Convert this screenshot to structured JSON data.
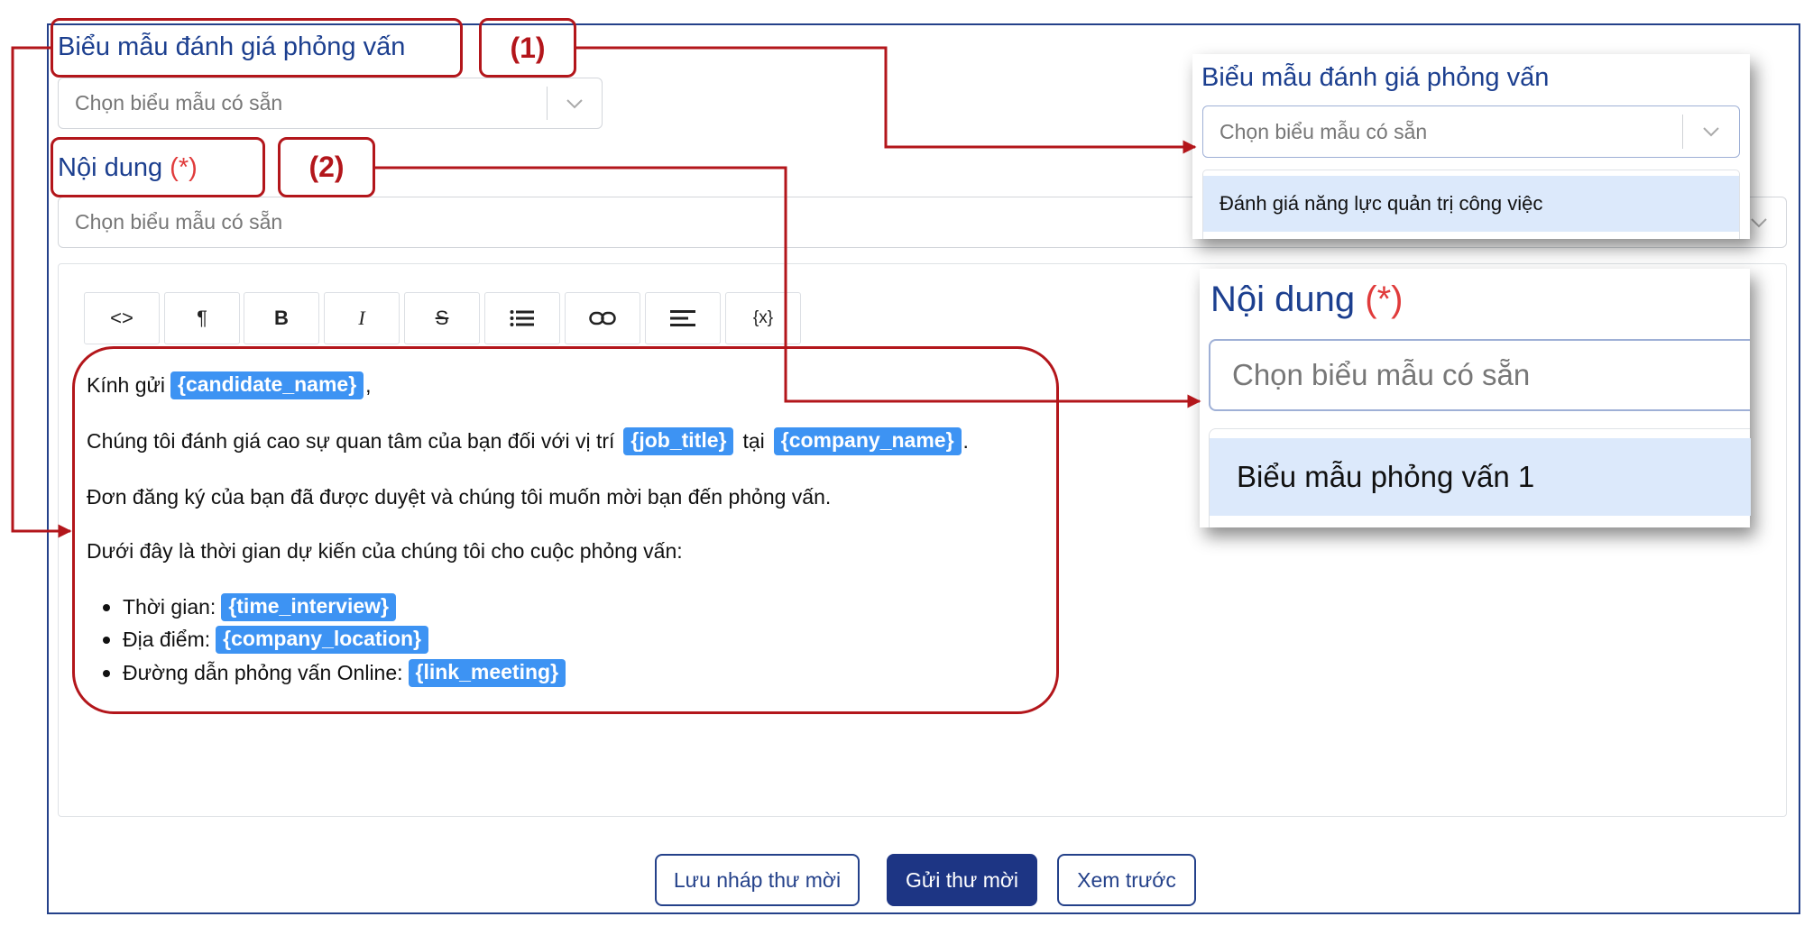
{
  "form": {
    "template_label": "Biểu mẫu đánh giá phỏng vấn",
    "template_placeholder": "Chọn biểu mẫu có sẵn",
    "content_label": "Nội dung",
    "required_mark": "(*)",
    "content_placeholder": "Chọn biểu mẫu có sẵn"
  },
  "toolbar": {
    "code": "<>",
    "paragraph": "¶",
    "bold": "B",
    "italic": "I",
    "strike": "S",
    "variable": "{x}"
  },
  "editor": {
    "greeting": "Kính gửi",
    "tag_candidate": "{candidate_name}",
    "comma": ",",
    "line2_pre": "Chúng tôi đánh giá cao sự quan tâm của bạn đối với vị trí",
    "tag_job": "{job_title}",
    "line2_mid": "tại",
    "tag_company": "{company_name}",
    "period": ".",
    "line3": "Đơn đăng ký của bạn đã được duyệt và chúng tôi muốn mời bạn đến phỏng vấn.",
    "line4": "Dưới đây là thời gian dự kiến của chúng tôi cho cuộc phỏng vấn:",
    "bullets": [
      {
        "label": "Thời gian:",
        "tag": "{time_interview}"
      },
      {
        "label": "Địa điểm:",
        "tag": "{company_location}"
      },
      {
        "label": "Đường dẫn phỏng vấn Online:",
        "tag": "{link_meeting}"
      }
    ]
  },
  "annotations": {
    "n1": "(1)",
    "n2": "(2)",
    "color": "#b3161b"
  },
  "zoom1": {
    "label": "Biểu mẫu đánh giá phỏng vấn",
    "placeholder": "Chọn biểu mẫu có sẵn",
    "option": "Đánh giá năng lực quản trị công việc"
  },
  "zoom2": {
    "label": "Nội dung",
    "required_mark": "(*)",
    "placeholder": "Chọn biểu mẫu có sẵn",
    "option": "Biểu mẫu phỏng vấn 1"
  },
  "buttons": {
    "save_draft": "Lưu nháp thư mời",
    "send": "Gửi thư mời",
    "preview": "Xem trước"
  },
  "colors": {
    "accent": "#1d3584",
    "tag": "#3d93f3",
    "required": "#e03b3b"
  }
}
